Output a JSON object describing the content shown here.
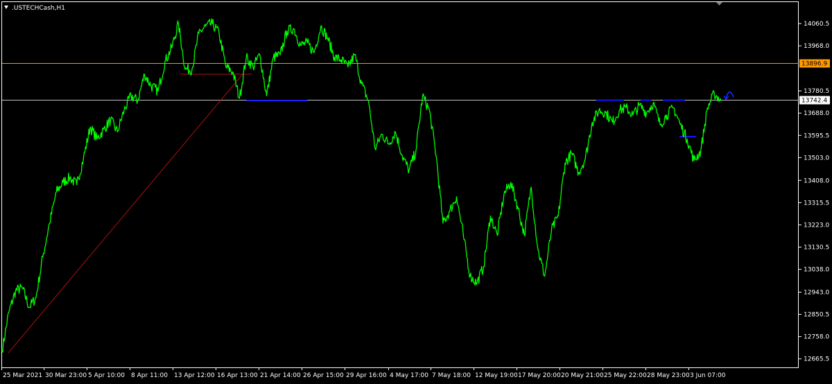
{
  "window": {
    "title": ".USTECHCash,H1",
    "menu_icon": "triangle-down-icon",
    "corner_icon": "triangle-down-icon"
  },
  "colors": {
    "background": "#000000",
    "foreground": "#ffffff",
    "price_line": "#00ff00",
    "resistance_line": "#ff9900",
    "current_price_line": "#c0c0c0",
    "trend_line": "#b01010",
    "support_segments": "#1515ff",
    "arrow": "#1a2dff"
  },
  "chart_data": {
    "type": "line",
    "title": ".USTECHCash,H1",
    "symbol": ".USTECHCash",
    "timeframe": "H1",
    "grid": false,
    "ylim": [
      12630,
      14150
    ],
    "y_ticks": [
      "14060.5",
      "13968.0",
      "13780.5",
      "13688.0",
      "13595.5",
      "13503.0",
      "13408.0",
      "13315.5",
      "13223.0",
      "13130.5",
      "13038.0",
      "12943.0",
      "12850.5",
      "12758.0",
      "12665.5"
    ],
    "x_ticks": [
      "25 Mar 2021",
      "30 Mar 23:00",
      "5 Apr 10:00",
      "8 Apr 11:00",
      "13 Apr 12:00",
      "16 Apr 13:00",
      "21 Apr 14:00",
      "26 Apr 15:00",
      "29 Apr 16:00",
      "4 May 17:00",
      "7 May 18:00",
      "12 May 19:00",
      "17 May 20:00",
      "20 May 21:00",
      "25 May 22:00",
      "28 May 23:00",
      "3 Jun 07:00"
    ],
    "horizontal_levels": [
      {
        "value": 13896.9,
        "label": "13896.9",
        "style": "resistance"
      },
      {
        "value": 13742.4,
        "label": "13742.4",
        "style": "current"
      }
    ],
    "series": [
      {
        "points": [
          [
            0,
            12700
          ],
          [
            1,
            12860
          ],
          [
            2,
            12950
          ],
          [
            3,
            12960
          ],
          [
            4,
            12880
          ],
          [
            5,
            12920
          ],
          [
            6,
            13090
          ],
          [
            7,
            13230
          ],
          [
            8,
            13360
          ],
          [
            9,
            13400
          ],
          [
            10,
            13420
          ],
          [
            11,
            13390
          ],
          [
            12,
            13500
          ],
          [
            13,
            13630
          ],
          [
            14,
            13580
          ],
          [
            15,
            13620
          ],
          [
            16,
            13660
          ],
          [
            17,
            13610
          ],
          [
            18,
            13700
          ],
          [
            19,
            13760
          ],
          [
            20,
            13740
          ],
          [
            21,
            13850
          ],
          [
            22,
            13800
          ],
          [
            23,
            13780
          ],
          [
            24,
            13900
          ],
          [
            25,
            13960
          ],
          [
            26,
            14060
          ],
          [
            27,
            13870
          ],
          [
            28,
            13870
          ],
          [
            29,
            14020
          ],
          [
            30,
            14050
          ],
          [
            31,
            14060
          ],
          [
            32,
            14020
          ],
          [
            33,
            13880
          ],
          [
            34,
            13860
          ],
          [
            35,
            13750
          ],
          [
            36,
            13920
          ],
          [
            37,
            13880
          ],
          [
            38,
            13930
          ],
          [
            39,
            13760
          ],
          [
            40,
            13920
          ],
          [
            41,
            13930
          ],
          [
            42,
            14030
          ],
          [
            43,
            14040
          ],
          [
            44,
            13970
          ],
          [
            45,
            13980
          ],
          [
            46,
            13940
          ],
          [
            47,
            14050
          ],
          [
            48,
            14000
          ],
          [
            49,
            13920
          ],
          [
            50,
            13910
          ],
          [
            51,
            13880
          ],
          [
            52,
            13930
          ],
          [
            53,
            13810
          ],
          [
            54,
            13740
          ],
          [
            55,
            13540
          ],
          [
            56,
            13600
          ],
          [
            57,
            13560
          ],
          [
            58,
            13610
          ],
          [
            59,
            13510
          ],
          [
            60,
            13450
          ],
          [
            61,
            13530
          ],
          [
            62,
            13760
          ],
          [
            63,
            13700
          ],
          [
            64,
            13510
          ],
          [
            65,
            13230
          ],
          [
            66,
            13280
          ],
          [
            67,
            13340
          ],
          [
            68,
            13180
          ],
          [
            69,
            13010
          ],
          [
            70,
            12980
          ],
          [
            71,
            13050
          ],
          [
            72,
            13260
          ],
          [
            73,
            13180
          ],
          [
            74,
            13350
          ],
          [
            75,
            13400
          ],
          [
            76,
            13300
          ],
          [
            77,
            13180
          ],
          [
            78,
            13380
          ],
          [
            79,
            13120
          ],
          [
            80,
            13010
          ],
          [
            81,
            13200
          ],
          [
            82,
            13260
          ],
          [
            83,
            13480
          ],
          [
            84,
            13520
          ],
          [
            85,
            13440
          ],
          [
            86,
            13500
          ],
          [
            87,
            13650
          ],
          [
            88,
            13700
          ],
          [
            89,
            13690
          ],
          [
            90,
            13650
          ],
          [
            91,
            13700
          ],
          [
            92,
            13710
          ],
          [
            93,
            13680
          ],
          [
            94,
            13720
          ],
          [
            95,
            13690
          ],
          [
            96,
            13730
          ],
          [
            97,
            13640
          ],
          [
            98,
            13680
          ],
          [
            99,
            13710
          ],
          [
            100,
            13640
          ],
          [
            101,
            13580
          ],
          [
            102,
            13490
          ],
          [
            103,
            13530
          ],
          [
            104,
            13710
          ],
          [
            105,
            13770
          ],
          [
            106,
            13740
          ]
        ]
      }
    ],
    "annotations": [
      {
        "type": "trend_line",
        "from": [
          1,
          12690
        ],
        "to": [
          45,
          13850
        ],
        "x_scale": "index-of-106"
      },
      {
        "type": "hline_segment",
        "value": 13850,
        "x_from": 32,
        "x_to": 45,
        "style": "trend"
      },
      {
        "type": "hline_segment",
        "value": 13740,
        "x_from": 44,
        "x_to": 55,
        "style": "support"
      },
      {
        "type": "hline_segment",
        "value": 13742,
        "x_from": 107,
        "x_to": 112,
        "style": "support"
      },
      {
        "type": "hline_segment",
        "value": 13742,
        "x_from": 115,
        "x_to": 117,
        "style": "support"
      },
      {
        "type": "hline_segment",
        "value": 13742,
        "x_from": 119,
        "x_to": 123,
        "style": "support"
      },
      {
        "type": "hline_segment",
        "value": 13590,
        "x_from": 122,
        "x_to": 125,
        "style": "support"
      },
      {
        "type": "arrow",
        "at": [
          131,
          13760
        ],
        "direction": "up"
      }
    ]
  }
}
